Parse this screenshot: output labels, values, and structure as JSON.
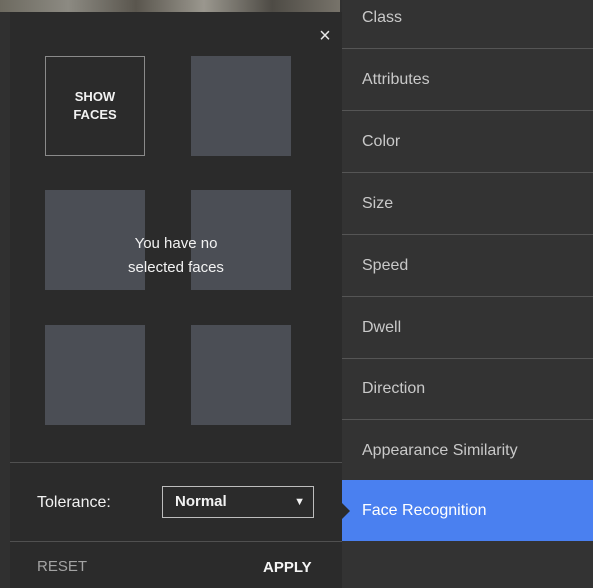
{
  "face_panel": {
    "close_icon": "×",
    "show_faces_label": "SHOW\nFACES",
    "empty_message_line1": "You have no",
    "empty_message_line2": "selected faces",
    "tolerance_label": "Tolerance:",
    "tolerance_value": "Normal",
    "reset_label": "RESET",
    "apply_label": "APPLY"
  },
  "menu": {
    "items": [
      {
        "label": "Class"
      },
      {
        "label": "Attributes"
      },
      {
        "label": "Color"
      },
      {
        "label": "Size"
      },
      {
        "label": "Speed"
      },
      {
        "label": "Dwell"
      },
      {
        "label": "Direction"
      },
      {
        "label": "Appearance Similarity"
      },
      {
        "label": "Face Recognition",
        "active": true
      }
    ]
  },
  "colors": {
    "accent": "#4a80f0",
    "panel_bg": "#2b2b2b",
    "face_slot": "#4b4e55"
  }
}
